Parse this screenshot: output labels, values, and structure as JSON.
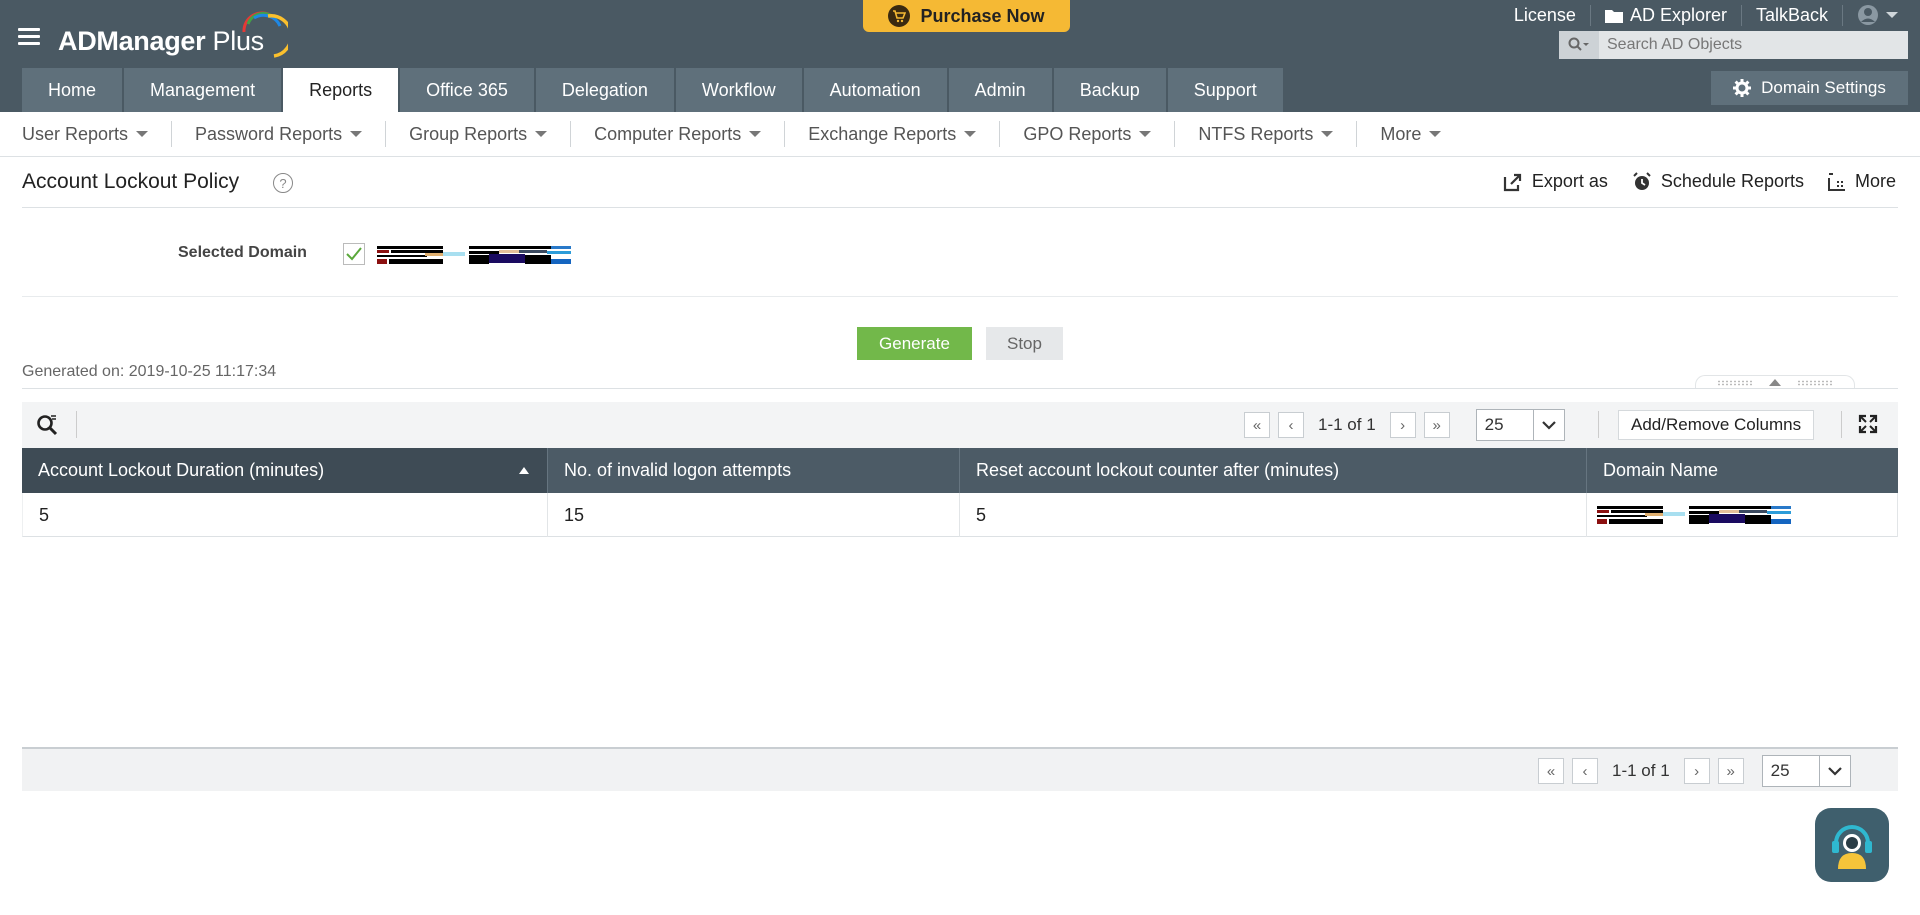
{
  "header": {
    "app_name_bold": "ADManager",
    "app_name_light": " Plus",
    "purchase_label": "Purchase Now",
    "top_links": {
      "license": "License",
      "ad_explorer": "AD Explorer",
      "talkback": "TalkBack"
    },
    "search": {
      "placeholder": "Search AD Objects"
    },
    "tabs": [
      "Home",
      "Management",
      "Reports",
      "Office 365",
      "Delegation",
      "Workflow",
      "Automation",
      "Admin",
      "Backup",
      "Support"
    ],
    "active_tab": "Reports",
    "domain_settings_label": "Domain Settings"
  },
  "subnav": {
    "items": [
      "User Reports",
      "Password Reports",
      "Group Reports",
      "Computer Reports",
      "Exchange Reports",
      "GPO Reports",
      "NTFS Reports",
      "More"
    ]
  },
  "page": {
    "title": "Account Lockout Policy",
    "help_icon": "question-circle-icon",
    "actions": {
      "export": "Export as",
      "schedule": "Schedule Reports",
      "more": "More"
    },
    "selected_domain_label": "Selected Domain",
    "selected_domain_checked": true,
    "generate_label": "Generate",
    "stop_label": "Stop",
    "generated_on": "Generated on: 2019-10-25 11:17:34"
  },
  "table": {
    "pager_text": "1-1 of 1",
    "page_size": "25",
    "add_remove_label": "Add/Remove Columns",
    "columns": [
      "Account Lockout Duration (minutes)",
      "No. of invalid logon attempts",
      "Reset account lockout counter after (minutes)",
      "Domain Name"
    ],
    "sorted_column": "Account Lockout Duration (minutes)",
    "sort_direction": "ascending",
    "rows": [
      {
        "duration": "5",
        "attempts": "15",
        "reset_after": "5"
      }
    ]
  },
  "bottom_pager": {
    "pager_text": "1-1 of 1",
    "page_size": "25"
  },
  "colors": {
    "header_bg": "#4a5963",
    "tab_bg": "#5f707b",
    "purchase": "#f5b934",
    "generate": "#72b84a",
    "table_header": "#4c5b66"
  }
}
